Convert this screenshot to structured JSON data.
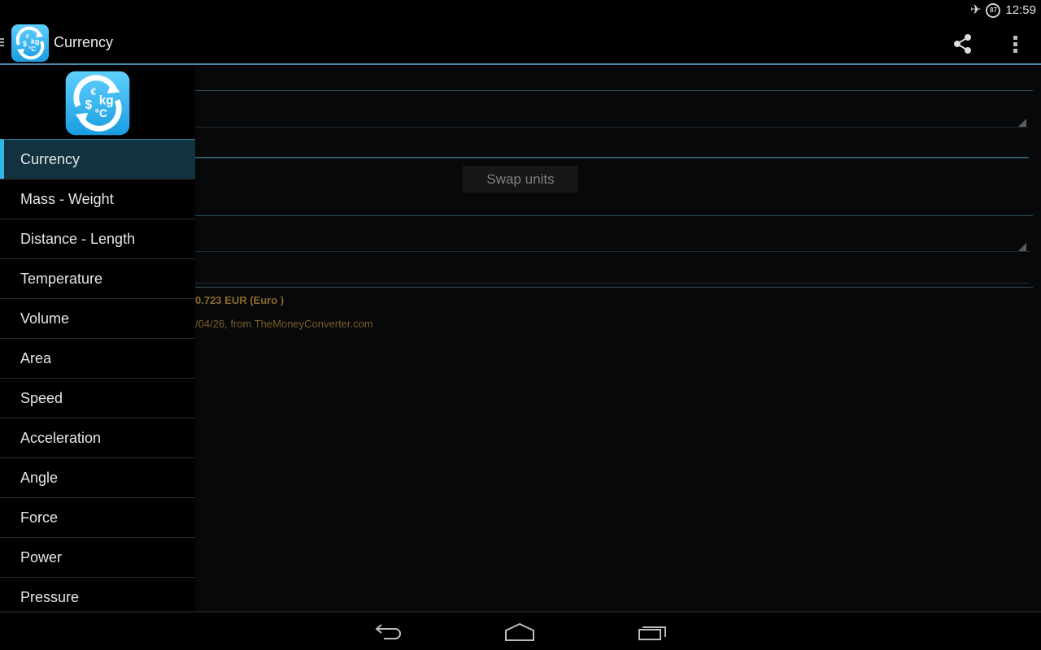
{
  "status_bar": {
    "airplane_icon": "airplane-mode-icon",
    "battery_level": "87",
    "time": "12:59"
  },
  "action_bar": {
    "title": "Currency",
    "share_icon": "share-icon",
    "overflow_icon": "overflow-menu-icon"
  },
  "drawer": {
    "items": [
      {
        "label": "Currency",
        "active": true
      },
      {
        "label": "Mass - Weight"
      },
      {
        "label": "Distance - Length"
      },
      {
        "label": "Temperature"
      },
      {
        "label": "Volume"
      },
      {
        "label": "Area"
      },
      {
        "label": "Speed"
      },
      {
        "label": "Acceleration"
      },
      {
        "label": "Angle"
      },
      {
        "label": "Force"
      },
      {
        "label": "Power"
      },
      {
        "label": "Pressure"
      }
    ]
  },
  "main": {
    "swap_label": "Swap units",
    "result_text": "0.723 EUR (Euro )",
    "source_text": "/04/26, from TheMoneyConverter.com"
  },
  "colors": {
    "accent": "#33b5e5",
    "result_text": "#8b6a2c"
  }
}
